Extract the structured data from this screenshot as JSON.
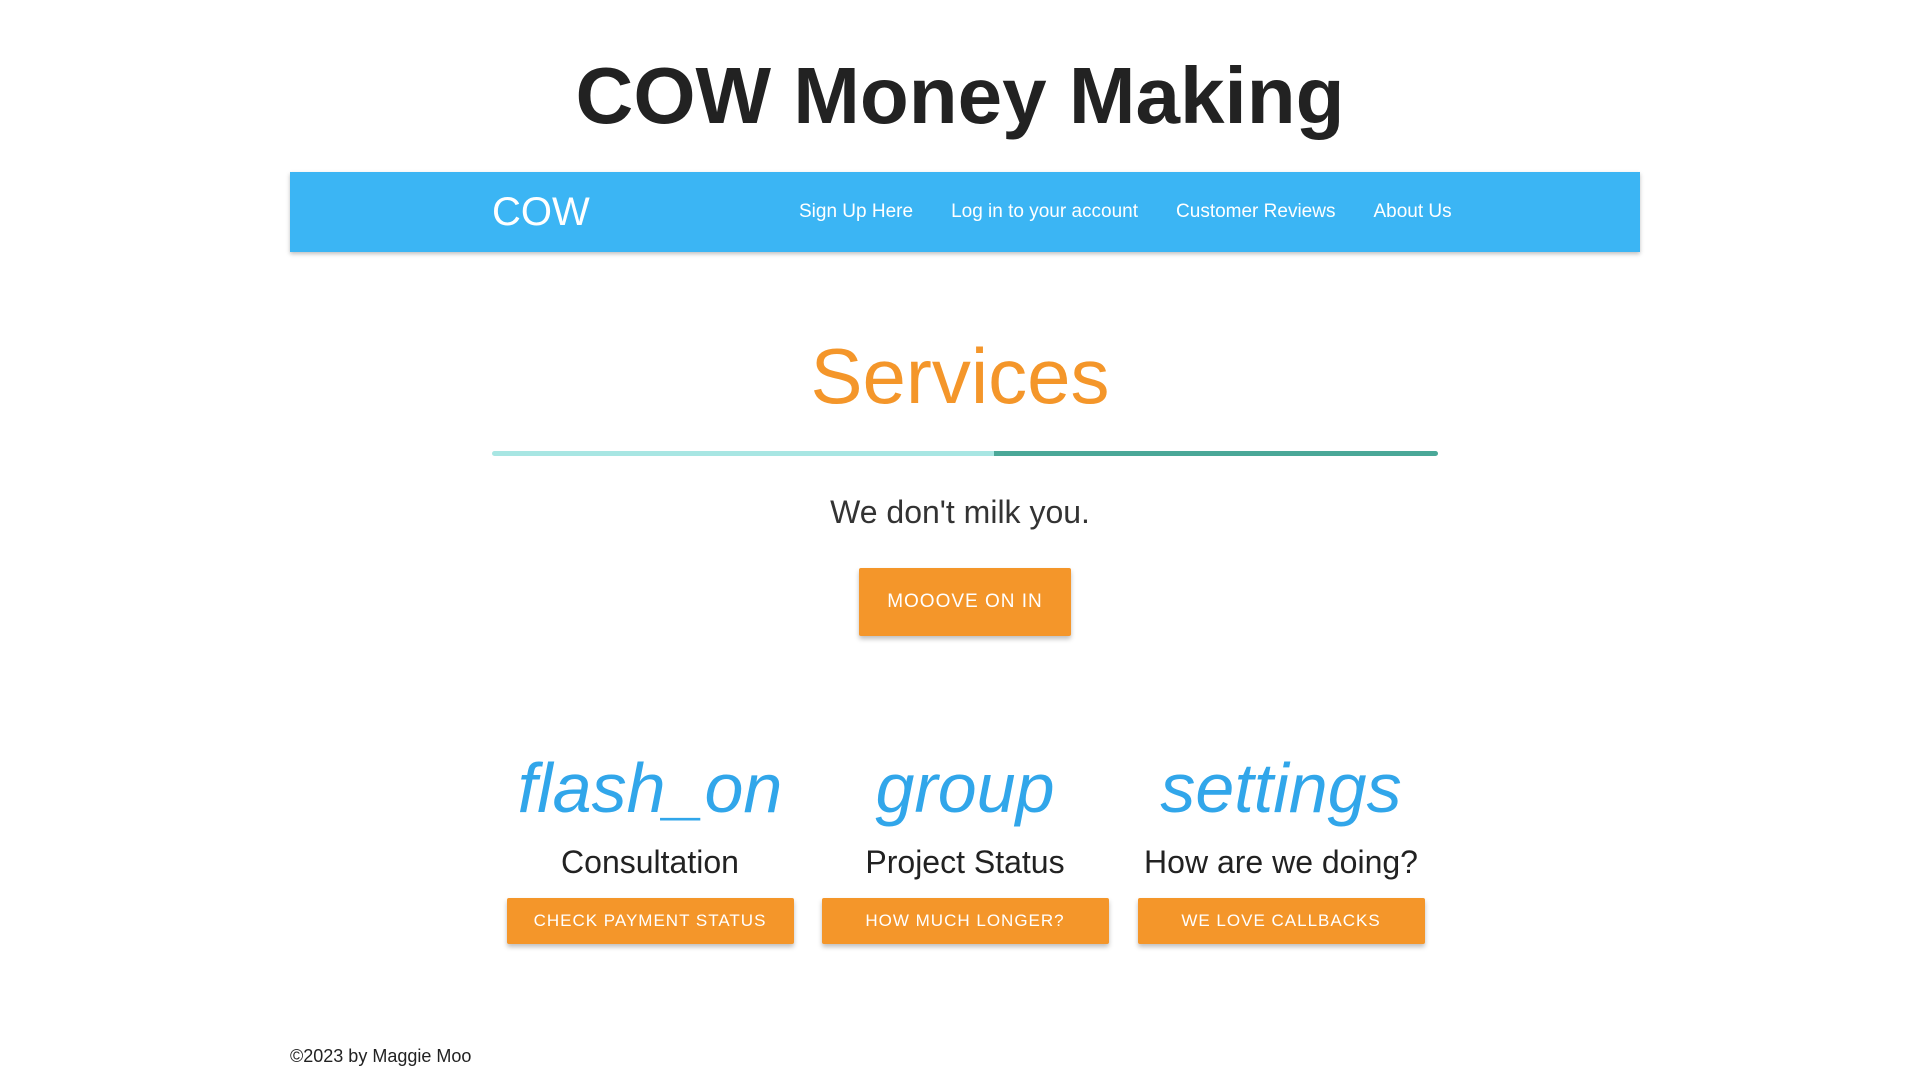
{
  "page": {
    "title": "COW Money Making"
  },
  "navbar": {
    "brand": "COW",
    "links": [
      "Sign Up Here",
      "Log in to your account",
      "Customer Reviews",
      "About Us"
    ],
    "background_color": "#3bb5f4"
  },
  "hero": {
    "heading": "Services",
    "tagline": "We don't milk you.",
    "cta_label": "MOOOVE ON IN",
    "accent_color": "#f4962a"
  },
  "features": [
    {
      "icon": "flash_on",
      "title": "Consultation",
      "button_label": "CHECK PAYMENT STATUS"
    },
    {
      "icon": "group",
      "title": "Project Status",
      "button_label": "HOW MUCH LONGER?"
    },
    {
      "icon": "settings",
      "title": "How are we doing?",
      "button_label": "WE LOVE CALLBACKS"
    }
  ],
  "footer": {
    "text": "©2023 by Maggie Moo"
  }
}
